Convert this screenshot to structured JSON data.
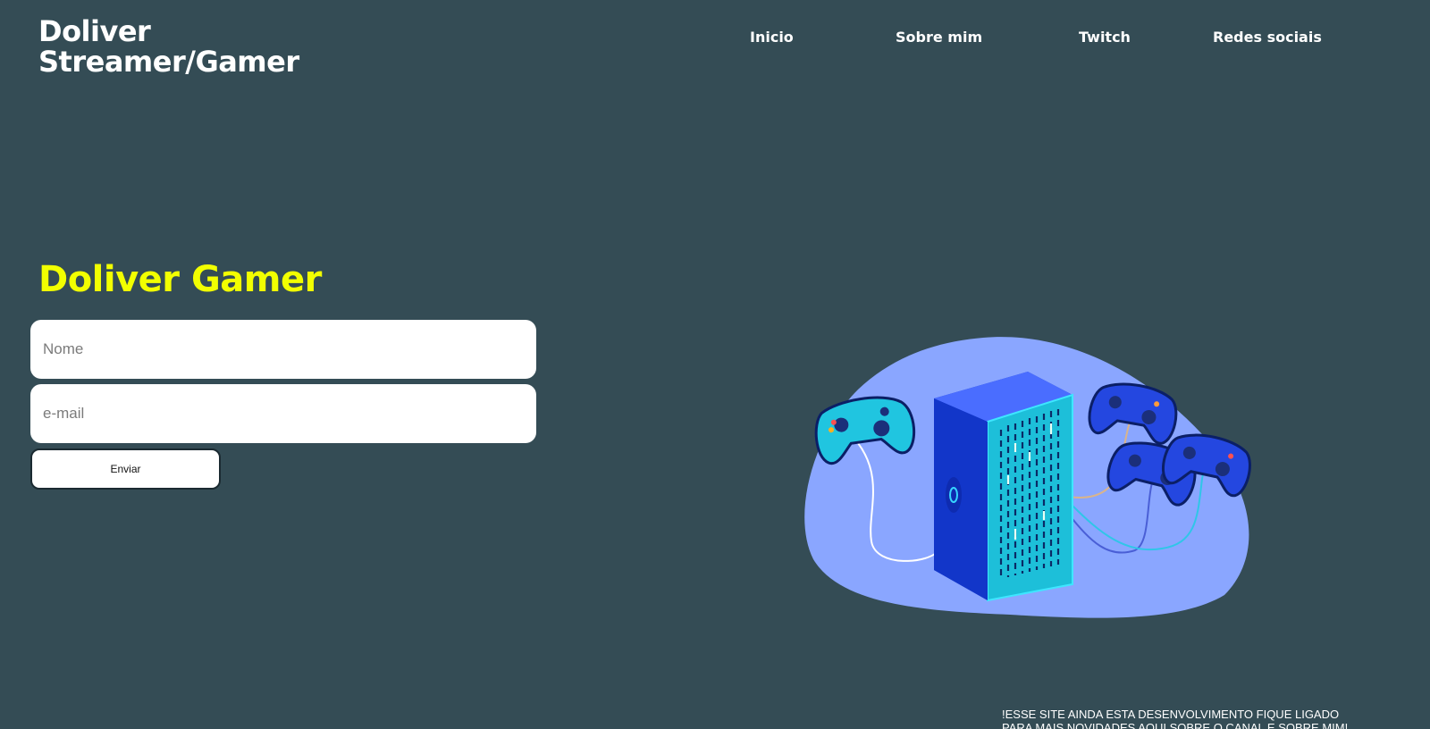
{
  "brand": {
    "line1": "Doliver",
    "line2": "Streamer/Gamer"
  },
  "nav": {
    "items": [
      {
        "label": "Inicio"
      },
      {
        "label": "Sobre mim"
      },
      {
        "label": "Twitch"
      },
      {
        "label": "Redes sociais"
      }
    ]
  },
  "hero": {
    "title": "Doliver Gamer"
  },
  "form": {
    "name_placeholder": "Nome",
    "name_value": "",
    "email_placeholder": "e-mail",
    "email_value": "",
    "submit_label": "Enviar"
  },
  "illustration": {
    "icon": "gaming-console-with-controllers",
    "colors": {
      "blob": "#8aa6ff",
      "tower_front": "#1a3fd6",
      "tower_side": "#1dbfd9",
      "controller_cyan": "#20c5e0",
      "controller_blue": "#2447e0"
    }
  },
  "footer": {
    "line1": "!ESSE SITE AINDA ESTA DESENVOLVIMENTO FIQUE LIGADO",
    "line2": "PARA MAIS NOVIDADES AQUI SOBRE O CANAL E SOBRE MIM!"
  },
  "colors": {
    "background": "#344c55",
    "accent": "#f2ff00",
    "text": "#ffffff"
  }
}
